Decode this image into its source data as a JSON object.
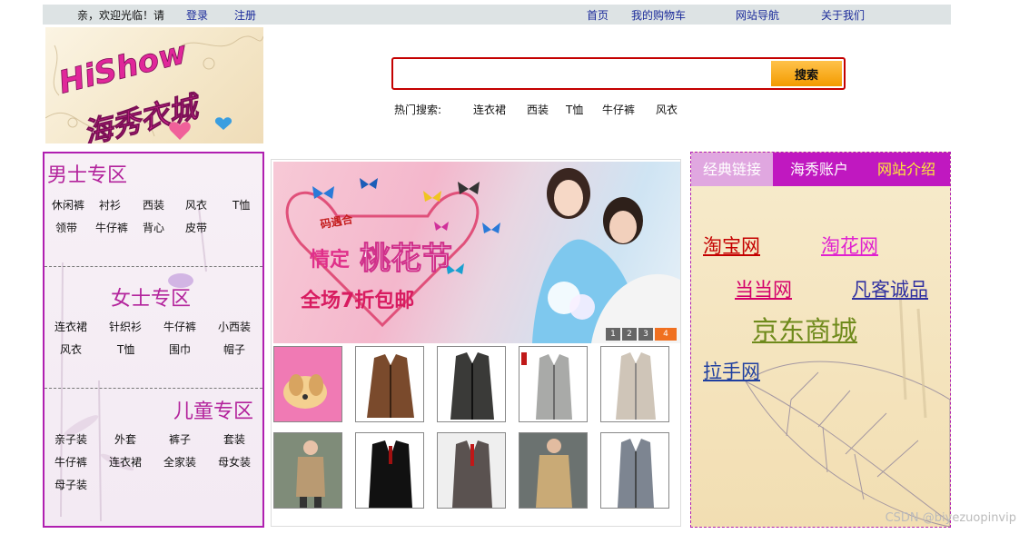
{
  "topbar": {
    "greeting": "亲，欢迎光临！请",
    "login": "登录",
    "register": "注册",
    "home": "首页",
    "cart": "我的购物车",
    "sitenav": "网站导航",
    "about": "关于我们"
  },
  "logo": {
    "text_en": "HiShow",
    "text_cn": "海秀衣城"
  },
  "search": {
    "value": "",
    "button": "搜索"
  },
  "hot_search": {
    "label": "热门搜索:",
    "items": [
      "连衣裙",
      "西装",
      "T恤",
      "牛仔裤",
      "风衣"
    ]
  },
  "categories": [
    {
      "title": "男士专区",
      "items": [
        "休闲裤",
        "衬衫",
        "西装",
        "风衣",
        "T恤",
        "领带",
        "牛仔裤",
        "背心",
        "皮带"
      ]
    },
    {
      "title": "女士专区",
      "items": [
        "连衣裙",
        "针织衫",
        "牛仔裤",
        "小西装",
        "风衣",
        "T恤",
        "围巾",
        "帽子"
      ]
    },
    {
      "title": "儿童专区",
      "items": [
        "亲子装",
        "外套",
        "裤子",
        "套装",
        "牛仔裤",
        "连衣裙",
        "全家装",
        "母女装",
        "母子装"
      ]
    }
  ],
  "banner": {
    "brand": "码遇合",
    "headline_a": "情定",
    "headline_b": "桃花节",
    "promo": "全场7折包邮",
    "pages": [
      "1",
      "2",
      "3",
      "4"
    ],
    "active_page": "4"
  },
  "right_panel": {
    "tabs": [
      "经典链接",
      "海秀账户",
      "网站介绍"
    ],
    "active_tab": 0,
    "links": [
      {
        "text": "淘宝网",
        "color": "#c40000"
      },
      {
        "text": "淘花网",
        "color": "#e020d0"
      },
      {
        "text": "当当网",
        "color": "#d4006a"
      },
      {
        "text": "凡客诚品",
        "color": "#3030a0"
      },
      {
        "text": "京东商城",
        "color": "#6f8a1c"
      },
      {
        "text": "拉手网",
        "color": "#1f3fa0"
      }
    ]
  },
  "watermark": "CSDN @biyezuopinvip",
  "colors": {
    "accent": "#b01fb0",
    "search_border": "#c40000",
    "search_button": "#f39b00",
    "tab_bar": "#c018c0"
  }
}
